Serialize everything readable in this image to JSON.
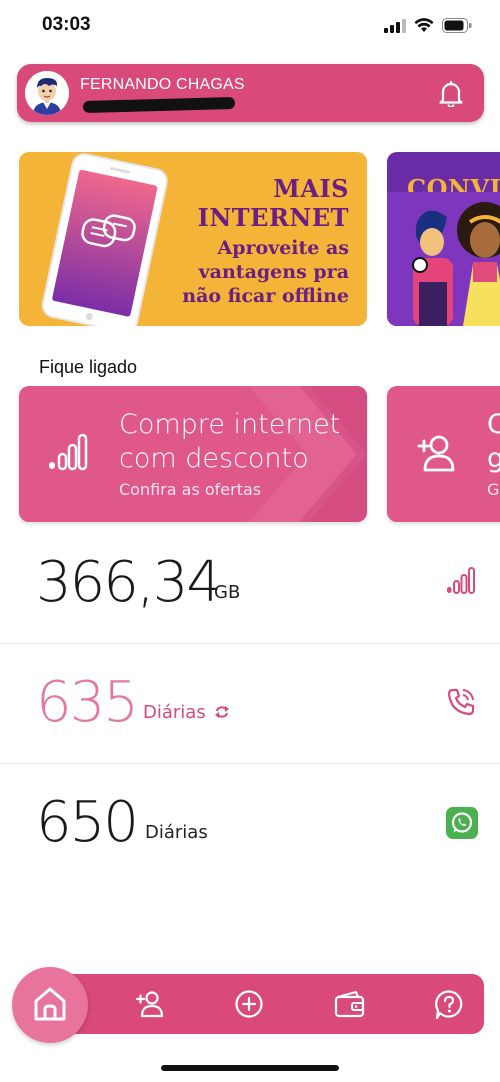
{
  "status_bar": {
    "time": "03:03"
  },
  "profile": {
    "name": "FERNANDO CHAGAS"
  },
  "banners": [
    {
      "title_line1": "MAIS",
      "title_line2": "INTERNET",
      "sub_line1": "Aproveite as",
      "sub_line2": "vantagens pra",
      "sub_line3": "não ficar offline"
    },
    {
      "title": "CONVID"
    }
  ],
  "section_title": "Fique ligado",
  "offers": [
    {
      "title_line1": "Compre internet",
      "title_line2": "com desconto",
      "subtitle": "Confira as ofertas"
    },
    {
      "title_line1": "C",
      "title_line2": "g",
      "subtitle": "Ga"
    }
  ],
  "balances": {
    "data": {
      "value": "366,34",
      "unit": "GB"
    },
    "calls": {
      "value": "635",
      "unit": "Diárias"
    },
    "whatsapp": {
      "value": "650",
      "unit": "Diárias"
    }
  },
  "colors": {
    "primary": "#d9497a",
    "accent_light": "#e8739c",
    "banner_yellow": "#f3b438",
    "banner_purple": "#6c1f82",
    "calls_pink": "#e07aa2",
    "whatsapp_green": "#4caf50"
  },
  "icons": {
    "bell": "bell-icon",
    "signal": "signal-bars-icon",
    "phone": "phone-icon",
    "whatsapp": "whatsapp-icon",
    "nav": [
      "home-icon",
      "add-user-icon",
      "plus-circle-icon",
      "wallet-icon",
      "help-icon"
    ]
  }
}
